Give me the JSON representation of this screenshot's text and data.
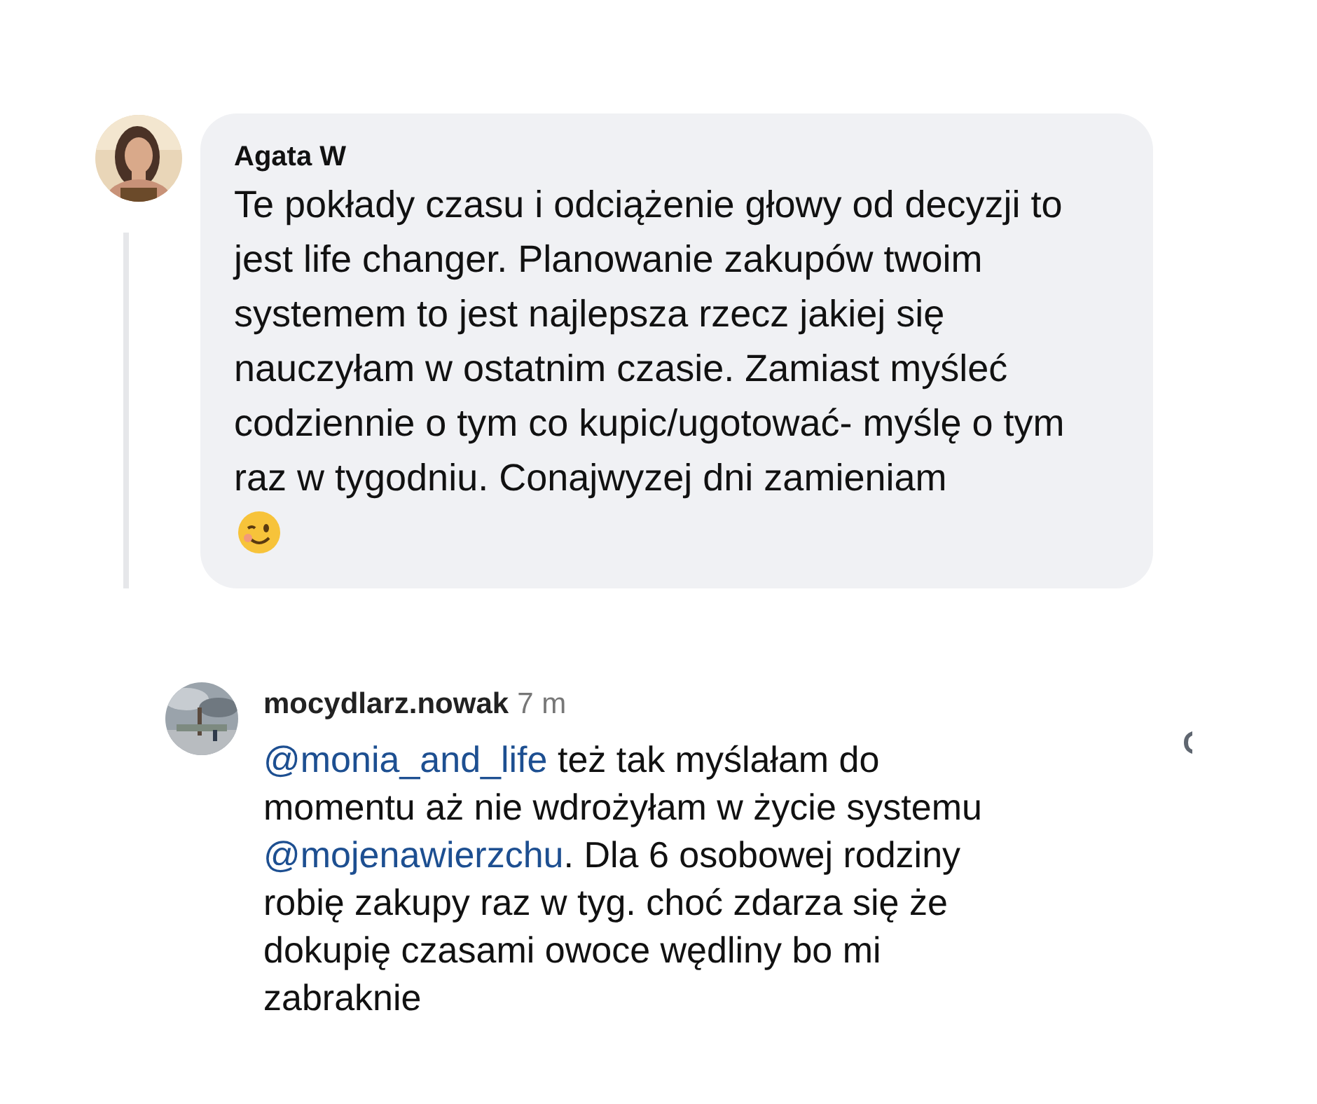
{
  "comments": [
    {
      "author": "Agata W",
      "text": "Te pokłady czasu i odciążenie głowy od decyzji to jest life changer. Planowanie zakupów twoim systemem to jest najlepsza rzecz jakiej się nauczyłam w ostatnim czasie. Zamiast myśleć codziennie o tym co kupic/ugotować- myślę o tym raz w tygodniu. Conajwyzej dni zamieniam"
    },
    {
      "author": "mocydlarz.nowak",
      "time": "7 m",
      "parts": [
        {
          "kind": "mention",
          "text": "@monia_and_life"
        },
        {
          "kind": "text",
          "text": " też tak myślałam do momentu aż nie wdrożyłam w życie systemu "
        },
        {
          "kind": "mention",
          "text": "@mojenawierzchu"
        },
        {
          "kind": "text",
          "text": ". Dla 6 osobowej rodziny robię zakupy raz w tyg. choć zdarza się że dokupię czasami owoce wędliny bo mi zabraknie"
        }
      ]
    }
  ]
}
